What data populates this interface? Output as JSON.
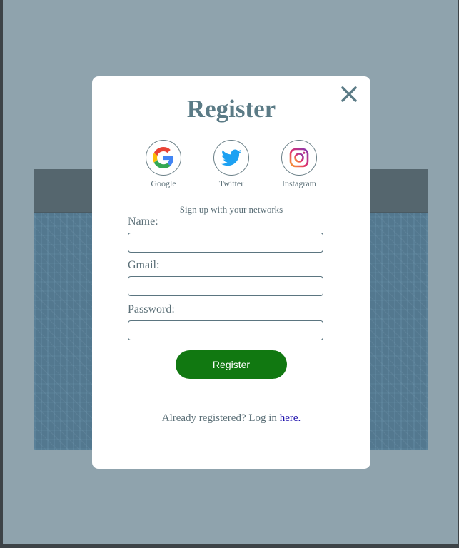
{
  "modal": {
    "title": "Register",
    "close_icon": "close-icon",
    "socials": [
      {
        "label": "Google",
        "icon": "google-icon"
      },
      {
        "label": "Twitter",
        "icon": "twitter-icon"
      },
      {
        "label": "Instagram",
        "icon": "instagram-icon"
      }
    ],
    "networks_text": "Sign up with your networks",
    "fields": {
      "name_label": "Name:",
      "name_value": "",
      "gmail_label": "Gmail:",
      "gmail_value": "",
      "password_label": "Password:",
      "password_value": ""
    },
    "register_label": "Register",
    "login_prefix": "Already registered? Log in ",
    "login_link": "here."
  },
  "colors": {
    "backdrop": "#8fa3ad",
    "title": "#5b7b86",
    "register_button": "#117811",
    "link": "#1a0dab",
    "twitter": "#1da1f2"
  }
}
